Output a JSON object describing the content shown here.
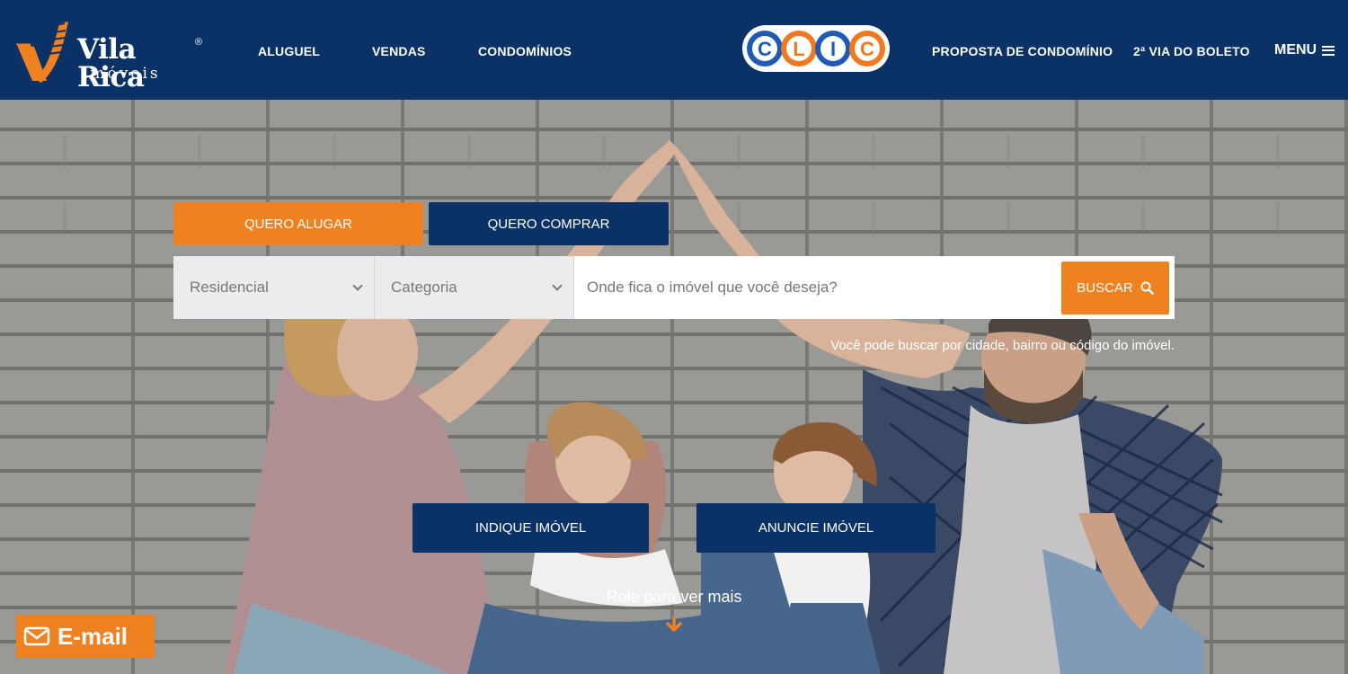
{
  "brand": {
    "name": "Vila Rica",
    "subtitle": "imóveis",
    "registered": "®"
  },
  "nav": {
    "left": [
      {
        "label": "ALUGUEL"
      },
      {
        "label": "VENDAS"
      },
      {
        "label": "CONDOMÍNIOS"
      }
    ],
    "clic_letters": [
      "C",
      "L",
      "I",
      "C"
    ],
    "right": [
      {
        "label": "PROPOSTA DE CONDOMÍNIO"
      },
      {
        "label": "2ª VIA DO BOLETO"
      }
    ],
    "menu_label": "MENU"
  },
  "search": {
    "tabs": [
      {
        "label": "QUERO ALUGAR",
        "active": true
      },
      {
        "label": "QUERO COMPRAR",
        "active": false
      }
    ],
    "type_select": "Residencial",
    "category_select": "Categoria",
    "placeholder": "Onde fica o imóvel que você deseja?",
    "button_label": "BUSCAR",
    "hint": "Você pode buscar por cidade, bairro ou código do imóvel."
  },
  "actions": [
    {
      "label": "INDIQUE IMÓVEL"
    },
    {
      "label": "ANUNCIE IMÓVEL"
    }
  ],
  "scroll_label": "Role para ver mais",
  "email_label": "E-mail",
  "colors": {
    "navy": "#0a3266",
    "orange": "#f08121",
    "clic_blue": "#1f5bb5",
    "clic_orange": "#f0781e"
  },
  "icons": [
    "logo-v-icon",
    "search-icon",
    "chevron-down-icon",
    "arrow-down-icon",
    "mail-icon",
    "hamburger-icon"
  ]
}
